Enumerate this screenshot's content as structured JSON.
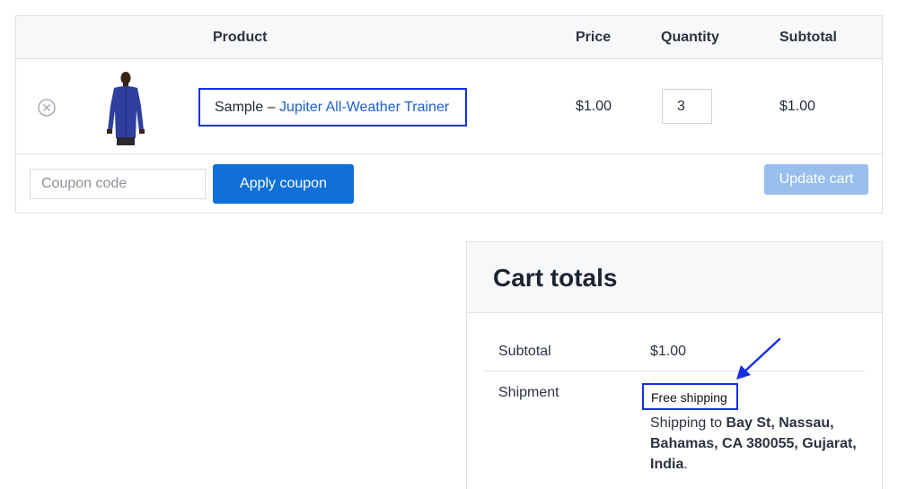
{
  "cart": {
    "columns": {
      "product": "Product",
      "price": "Price",
      "quantity": "Quantity",
      "subtotal": "Subtotal"
    },
    "item": {
      "name_prefix": "Sample – ",
      "name_link": "Jupiter All-Weather Trainer",
      "price": "$1.00",
      "quantity": "3",
      "subtotal": "$1.00"
    },
    "coupon": {
      "placeholder": "Coupon code",
      "apply_label": "Apply coupon"
    },
    "update_label": "Update cart"
  },
  "totals": {
    "title": "Cart totals",
    "subtotal_label": "Subtotal",
    "subtotal_value": "$1.00",
    "shipment_label": "Shipment",
    "free_shipping": "Free shipping",
    "shipping_to": "Shipping to ",
    "address": "Bay St, Nassau, Bahamas, CA 380055, Gujarat, India",
    "address_end": "."
  },
  "colors": {
    "primary_button": "#0f6fd6",
    "disabled_button": "#98bfec",
    "link": "#1a61c9",
    "highlight": "#1530e0"
  },
  "icons": {
    "remove": "remove-circle-x-icon",
    "annotation_arrow": "arrow-icon"
  }
}
